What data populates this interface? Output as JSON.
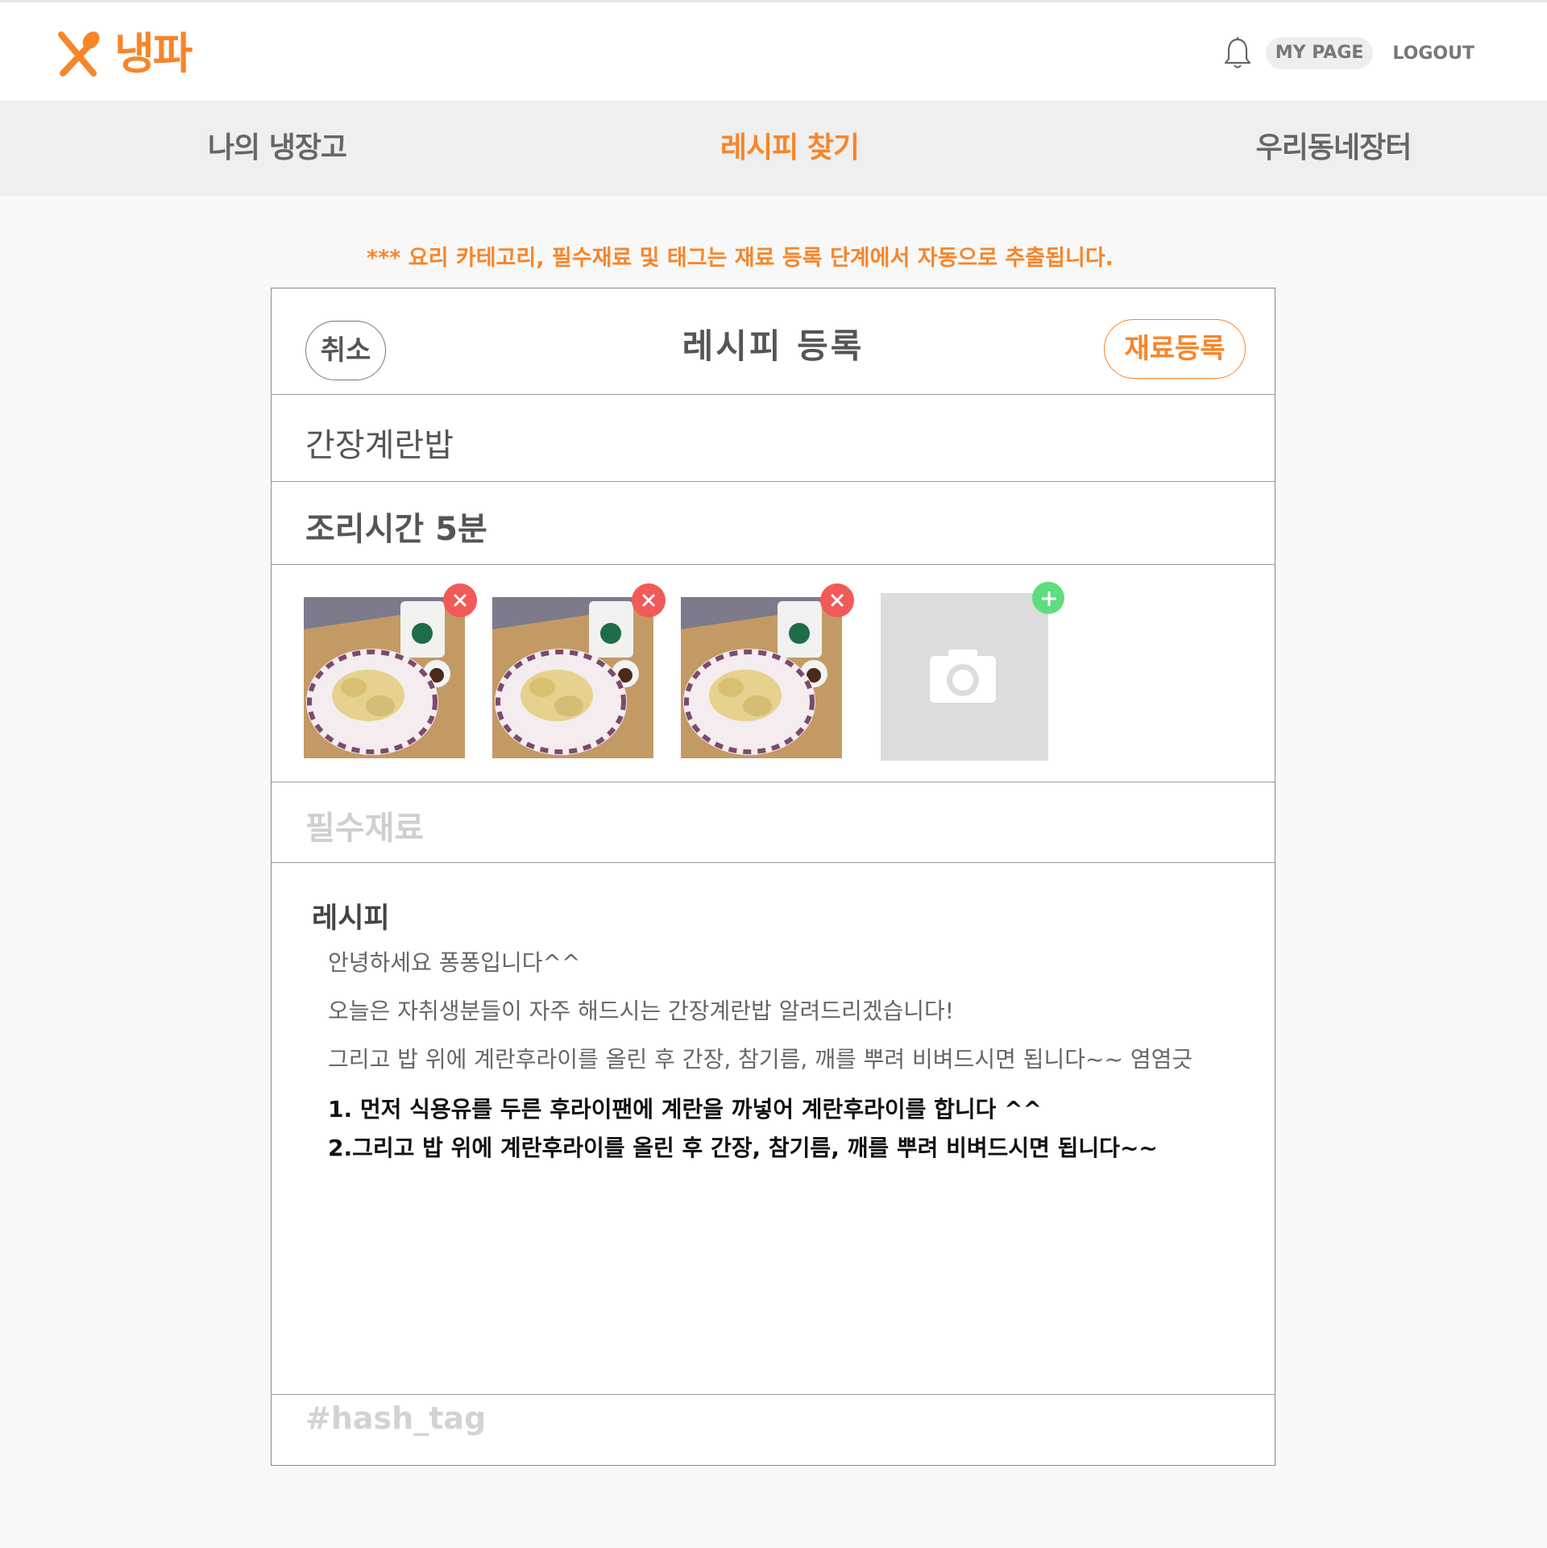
{
  "header": {
    "logo_text": "냉파",
    "mypage_label": "MY PAGE",
    "logout_label": "LOGOUT",
    "brand_color": "#f7852a"
  },
  "nav": {
    "items": [
      {
        "label": "나의 냉장고",
        "active": false
      },
      {
        "label": "레시피 찾기",
        "active": true
      },
      {
        "label": "우리동네장터",
        "active": false
      }
    ]
  },
  "notice": "*** 요리 카테고리, 필수재료 및 태그는  재료 등록 단계에서 자동으로 추출됩니다.",
  "form": {
    "cancel_label": "취소",
    "title": "레시피 등록",
    "register_label": "재료등록",
    "recipe_name": "간장계란밥",
    "cook_time": "조리시간 5분",
    "required_ingredients_placeholder": "필수재료",
    "recipe_heading": "레시피",
    "recipe_lines": [
      "안녕하세요 퐁퐁입니다^^",
      "오늘은 자취생분들이 자주 해드시는 간장계란밥 알려드리겠습니다!",
      "그리고 밥 위에 계란후라이를 올린 후 간장, 참기름, 깨를 뿌려 비벼드시면 됩니다~~ 염염긋"
    ],
    "recipe_steps": [
      "1. 먼저 식용유를 두른 후라이팬에 계란을 까넣어 계란후라이를 합니다 ^^",
      "2.그리고 밥 위에 계란후라이를 올린 후 간장, 참기름, 깨를 뿌려 비벼드시면 됩니다~~"
    ],
    "hashtag_placeholder": "#hash_tag",
    "photos": [
      {
        "icon": "food-photo"
      },
      {
        "icon": "food-photo"
      },
      {
        "icon": "food-photo"
      }
    ]
  }
}
